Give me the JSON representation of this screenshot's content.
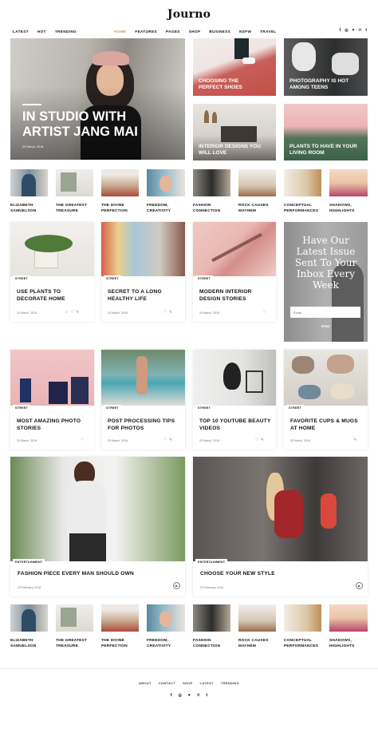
{
  "site": {
    "logo": "Journo"
  },
  "nav_left": [
    "LATEST",
    "HOT",
    "TRENDING"
  ],
  "nav_main": [
    "HOME",
    "FEATURES",
    "PAGES",
    "SHOP",
    "BUSINESS",
    "NSFW",
    "TRAVEL"
  ],
  "social": [
    "f",
    "◎",
    "♥",
    "℗",
    "t"
  ],
  "hero": {
    "tag": "",
    "title": "IN STUDIO WITH ARTIST JANG MAI",
    "date": "23 March, 2018"
  },
  "grid_tiles": [
    {
      "title": "CHOOSING THE PERFECT SHOES"
    },
    {
      "title": "PHOTOGRAPHY IS HOT AMONG TEENS"
    },
    {
      "title": "INTERIOR DESIGNS YOU WILL LOVE"
    },
    {
      "title": "PLANTS TO HAVE IN YOUR LIVING ROOM"
    }
  ],
  "thumbs": [
    "ELIZABETH SAMUELSON",
    "THE GREATEST TREASURE",
    "THE DIVINE PERFECTION",
    "FREEDOM, CREATIVITY",
    "FASHION CONNECTION",
    "ROCK CAUSES MAYHEM",
    "CONCEPTUAL PERFORMANCES",
    "SHADOWS, HIGHLIGHTS"
  ],
  "cards_row1": [
    {
      "tag": "STREET",
      "title": "USE PLANTS TO DECORATE HOME",
      "date": "24 March, 2018"
    },
    {
      "tag": "STREET",
      "title": "SECRET TO A LONG HEALTHY LIFE",
      "date": "24 March, 2018"
    },
    {
      "tag": "STREET",
      "title": "MODERN INTERIOR DESIGN STORIES",
      "date": "24 March, 2018"
    }
  ],
  "newsletter": {
    "title": "Have Our Latest Issue Sent To Your Inbox Every Week",
    "placeholder": "Email",
    "button": "SEND"
  },
  "cards_row2": [
    {
      "tag": "STREET",
      "title": "MOST AMAZING PHOTO STORIES",
      "date": "25 March, 2018"
    },
    {
      "tag": "STREET",
      "title": "POST PROCESSING TIPS FOR PHOTOS",
      "date": "25 March, 2018"
    },
    {
      "tag": "STREET",
      "title": "TOP 10 YOUTUBE BEAUTY VIDEOS",
      "date": "25 March, 2018"
    },
    {
      "tag": "STREET",
      "title": "FAVORITE CUPS & MUGS AT HOME",
      "date": "25 March, 2018"
    }
  ],
  "big_cards": [
    {
      "tag": "ENTERTAINMENT",
      "title": "FASHION PIECE EVERY MAN SHOULD OWN",
      "date": "23 February, 2018"
    },
    {
      "tag": "ENTERTAINMENT",
      "title": "CHOOSE YOUR NEW STYLE",
      "date": "23 February, 2018"
    }
  ],
  "footer_nav": [
    "ABOUT",
    "CONTACT",
    "SHOP",
    "LATEST",
    "TRENDING"
  ],
  "footer_social": [
    "f",
    "◎",
    "♥",
    "℗",
    "t"
  ]
}
